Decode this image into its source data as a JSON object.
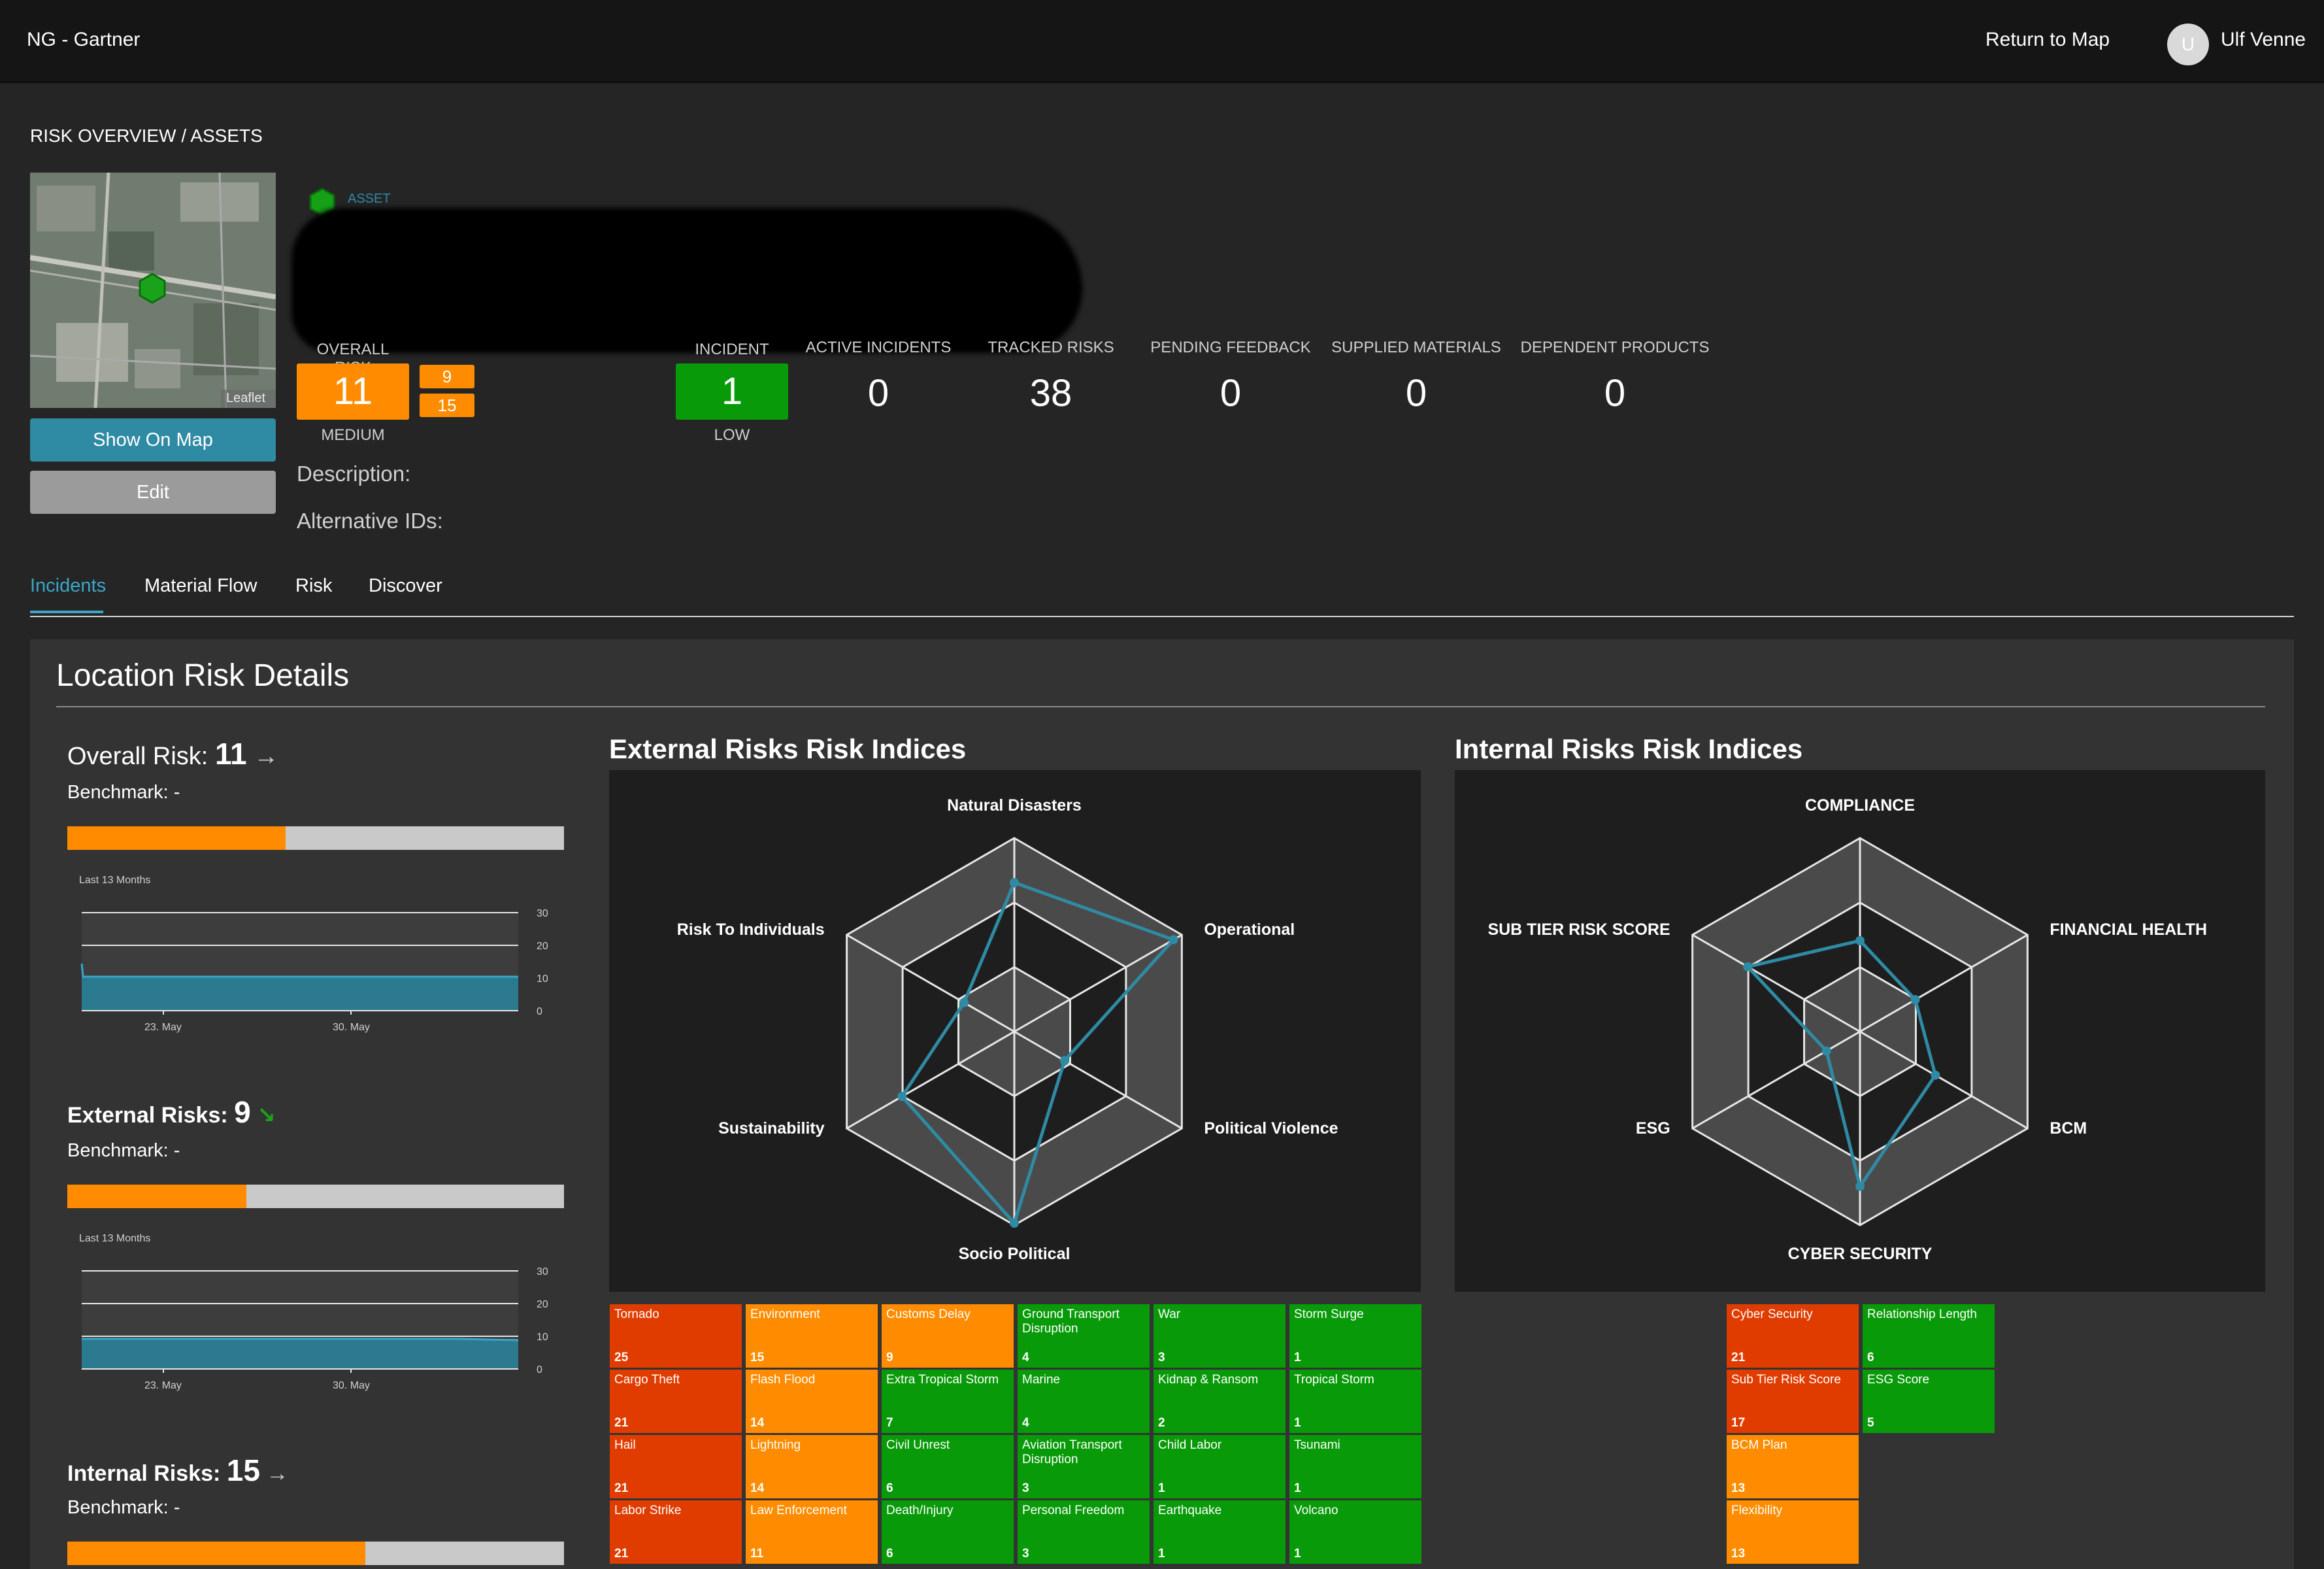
{
  "app": {
    "brand": "NG - Gartner",
    "return_link": "Return to Map",
    "user_initial": "U",
    "user_name": "Ulf Venne"
  },
  "breadcrumb": "RISK OVERVIEW  /  ASSETS",
  "asset": {
    "tag": "ASSET",
    "show_on_map": "Show On Map",
    "edit": "Edit",
    "overall_risk_label": "OVERALL RISK",
    "overall_risk_value": "11",
    "overall_risk_level": "MEDIUM",
    "external_mini": "9",
    "internal_mini": "15",
    "incident_label": "INCIDENT",
    "incident_value": "1",
    "incident_level": "LOW",
    "description_label": "Description:",
    "alt_ids_label": "Alternative IDs:",
    "stats": [
      {
        "label": "ACTIVE INCIDENTS",
        "value": "0"
      },
      {
        "label": "TRACKED RISKS",
        "value": "38"
      },
      {
        "label": "PENDING FEEDBACK",
        "value": "0"
      },
      {
        "label": "SUPPLIED MATERIALS",
        "value": "0"
      },
      {
        "label": "DEPENDENT PRODUCTS",
        "value": "0"
      }
    ],
    "map_attribution": "Leaflet"
  },
  "tabs": [
    "Incidents",
    "Material Flow",
    "Risk",
    "Discover"
  ],
  "panel_title": "Location Risk Details",
  "risk_stats": {
    "overall": {
      "label": "Overall Risk:",
      "value": "11",
      "arrow": "→",
      "benchmark": "Benchmark: -",
      "fill": 0.44,
      "trend_label": "Last 13 Months",
      "ticks_y": [
        "30",
        "20",
        "10",
        "0"
      ],
      "ticks_x": [
        "23. May",
        "30. May"
      ]
    },
    "external": {
      "label": "External Risks:",
      "value": "9",
      "arrow": "↘",
      "benchmark": "Benchmark: -",
      "fill": 0.36,
      "trend_label": "Last 13 Months",
      "ticks_y": [
        "30",
        "20",
        "10",
        "0"
      ],
      "ticks_x": [
        "23. May",
        "30. May"
      ]
    },
    "internal": {
      "label": "Internal Risks:",
      "value": "15",
      "arrow": "→",
      "benchmark": "Benchmark: -",
      "fill": 0.6
    }
  },
  "external_radar": {
    "title": "External Risks Risk Indices",
    "axes": [
      "Natural Disasters",
      "Operational",
      "Political Violence",
      "Socio Political",
      "Sustainability",
      "Risk To Individuals"
    ],
    "values": [
      0.77,
      0.95,
      0.3,
      0.99,
      0.67,
      0.3
    ]
  },
  "internal_radar": {
    "title": "Internal Risks Risk Indices",
    "axes": [
      "COMPLIANCE",
      "FINANCIAL HEALTH",
      "BCM",
      "CYBER SECURITY",
      "ESG",
      "SUB TIER RISK SCORE"
    ],
    "values": [
      0.47,
      0.33,
      0.45,
      0.8,
      0.2,
      0.67
    ]
  },
  "external_grid": [
    [
      {
        "name": "Tornado",
        "value": "25",
        "color": "red"
      },
      {
        "name": "Environment",
        "value": "15",
        "color": "orange"
      },
      {
        "name": "Customs Delay",
        "value": "9",
        "color": "orange"
      },
      {
        "name": "Ground Transport Disruption",
        "value": "4",
        "color": "green"
      },
      {
        "name": "War",
        "value": "3",
        "color": "green"
      },
      {
        "name": "Storm Surge",
        "value": "1",
        "color": "green"
      }
    ],
    [
      {
        "name": "Cargo Theft",
        "value": "21",
        "color": "red"
      },
      {
        "name": "Flash Flood",
        "value": "14",
        "color": "orange"
      },
      {
        "name": "Extra Tropical Storm",
        "value": "7",
        "color": "green"
      },
      {
        "name": "Marine",
        "value": "4",
        "color": "green"
      },
      {
        "name": "Kidnap & Ransom",
        "value": "2",
        "color": "green"
      },
      {
        "name": "Tropical Storm",
        "value": "1",
        "color": "green"
      }
    ],
    [
      {
        "name": "Hail",
        "value": "21",
        "color": "red"
      },
      {
        "name": "Lightning",
        "value": "14",
        "color": "orange"
      },
      {
        "name": "Civil Unrest",
        "value": "6",
        "color": "green"
      },
      {
        "name": "Aviation Transport Disruption",
        "value": "3",
        "color": "green"
      },
      {
        "name": "Child Labor",
        "value": "1",
        "color": "green"
      },
      {
        "name": "Tsunami",
        "value": "1",
        "color": "green"
      }
    ],
    [
      {
        "name": "Labor Strike",
        "value": "21",
        "color": "red"
      },
      {
        "name": "Law Enforcement",
        "value": "11",
        "color": "orange"
      },
      {
        "name": "Death/Injury",
        "value": "6",
        "color": "green"
      },
      {
        "name": "Personal Freedom",
        "value": "3",
        "color": "green"
      },
      {
        "name": "Earthquake",
        "value": "1",
        "color": "green"
      },
      {
        "name": "Volcano",
        "value": "1",
        "color": "green"
      }
    ]
  ],
  "internal_grid": [
    [
      {
        "name": "Cyber Security",
        "value": "21",
        "color": "red"
      },
      {
        "name": "Relationship Length",
        "value": "6",
        "color": "green"
      }
    ],
    [
      {
        "name": "Sub Tier Risk Score",
        "value": "17",
        "color": "red"
      },
      {
        "name": "ESG Score",
        "value": "5",
        "color": "green"
      }
    ],
    [
      {
        "name": "BCM Plan",
        "value": "13",
        "color": "orange"
      }
    ],
    [
      {
        "name": "Flexibility",
        "value": "13",
        "color": "orange"
      }
    ]
  ],
  "colors": {
    "accent": "#2f8aa3",
    "orange": "#ff8c00",
    "red": "#e03c00",
    "green": "#089a08",
    "radar_line": "#2f8aa3"
  }
}
